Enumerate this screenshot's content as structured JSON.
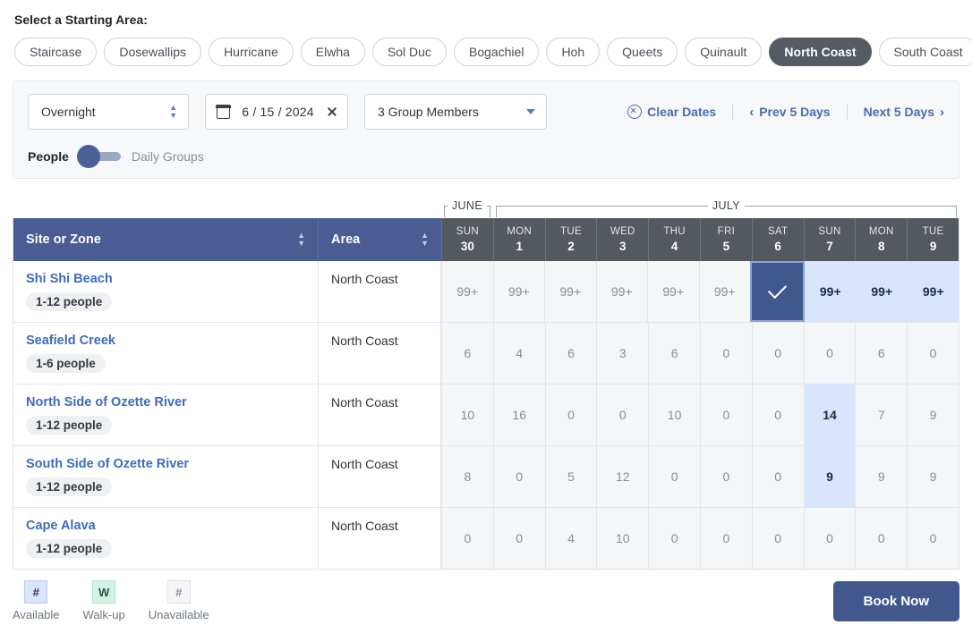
{
  "area_picker": {
    "label": "Select a Starting Area:",
    "chips": [
      {
        "label": "Staircase",
        "selected": false
      },
      {
        "label": "Dosewallips",
        "selected": false
      },
      {
        "label": "Hurricane",
        "selected": false
      },
      {
        "label": "Elwha",
        "selected": false
      },
      {
        "label": "Sol Duc",
        "selected": false
      },
      {
        "label": "Bogachiel",
        "selected": false
      },
      {
        "label": "Hoh",
        "selected": false
      },
      {
        "label": "Queets",
        "selected": false
      },
      {
        "label": "Quinault",
        "selected": false
      },
      {
        "label": "North Coast",
        "selected": true
      },
      {
        "label": "South Coast",
        "selected": false
      }
    ]
  },
  "filters": {
    "stay_type": "Overnight",
    "date_value": "6 / 15 / 2024",
    "group_size": "3 Group Members",
    "clear_dates": "Clear Dates",
    "prev_days": "Prev 5 Days",
    "next_days": "Next 5 Days",
    "prev_chevron": "‹",
    "next_chevron": "›",
    "toggle_left": "People",
    "toggle_right": "Daily Groups"
  },
  "months": [
    {
      "name": "JUNE",
      "span": 1
    },
    {
      "name": "JULY",
      "span": 9
    }
  ],
  "table": {
    "col_site": "Site or Zone",
    "col_area": "Area",
    "days": [
      {
        "dow": "SUN",
        "num": "30"
      },
      {
        "dow": "MON",
        "num": "1"
      },
      {
        "dow": "TUE",
        "num": "2"
      },
      {
        "dow": "WED",
        "num": "3"
      },
      {
        "dow": "THU",
        "num": "4"
      },
      {
        "dow": "FRI",
        "num": "5"
      },
      {
        "dow": "SAT",
        "num": "6"
      },
      {
        "dow": "SUN",
        "num": "7"
      },
      {
        "dow": "MON",
        "num": "8"
      },
      {
        "dow": "TUE",
        "num": "9"
      }
    ],
    "rows": [
      {
        "site": "Shi Shi Beach",
        "capacity": "1-12 people",
        "area": "North Coast",
        "cells": [
          {
            "value": "99+",
            "state": "plain"
          },
          {
            "value": "99+",
            "state": "plain"
          },
          {
            "value": "99+",
            "state": "plain"
          },
          {
            "value": "99+",
            "state": "plain"
          },
          {
            "value": "99+",
            "state": "plain"
          },
          {
            "value": "99+",
            "state": "plain"
          },
          {
            "value": "",
            "state": "selected"
          },
          {
            "value": "99+",
            "state": "avail"
          },
          {
            "value": "99+",
            "state": "avail"
          },
          {
            "value": "99+",
            "state": "avail"
          }
        ]
      },
      {
        "site": "Seafield Creek",
        "capacity": "1-6 people",
        "area": "North Coast",
        "cells": [
          {
            "value": "6",
            "state": "plain"
          },
          {
            "value": "4",
            "state": "plain"
          },
          {
            "value": "6",
            "state": "plain"
          },
          {
            "value": "3",
            "state": "plain"
          },
          {
            "value": "6",
            "state": "plain"
          },
          {
            "value": "0",
            "state": "plain"
          },
          {
            "value": "0",
            "state": "plain"
          },
          {
            "value": "0",
            "state": "plain"
          },
          {
            "value": "6",
            "state": "plain"
          },
          {
            "value": "0",
            "state": "plain"
          }
        ]
      },
      {
        "site": "North Side of Ozette River",
        "capacity": "1-12 people",
        "area": "North Coast",
        "cells": [
          {
            "value": "10",
            "state": "plain"
          },
          {
            "value": "16",
            "state": "plain"
          },
          {
            "value": "0",
            "state": "plain"
          },
          {
            "value": "0",
            "state": "plain"
          },
          {
            "value": "10",
            "state": "plain"
          },
          {
            "value": "0",
            "state": "plain"
          },
          {
            "value": "0",
            "state": "plain"
          },
          {
            "value": "14",
            "state": "avail"
          },
          {
            "value": "7",
            "state": "plain"
          },
          {
            "value": "9",
            "state": "plain"
          }
        ]
      },
      {
        "site": "South Side of Ozette River",
        "capacity": "1-12 people",
        "area": "North Coast",
        "cells": [
          {
            "value": "8",
            "state": "plain"
          },
          {
            "value": "0",
            "state": "plain"
          },
          {
            "value": "5",
            "state": "plain"
          },
          {
            "value": "12",
            "state": "plain"
          },
          {
            "value": "0",
            "state": "plain"
          },
          {
            "value": "0",
            "state": "plain"
          },
          {
            "value": "0",
            "state": "plain"
          },
          {
            "value": "9",
            "state": "avail"
          },
          {
            "value": "9",
            "state": "plain"
          },
          {
            "value": "9",
            "state": "plain"
          }
        ]
      },
      {
        "site": "Cape Alava",
        "capacity": "1-12 people",
        "area": "North Coast",
        "cells": [
          {
            "value": "0",
            "state": "plain"
          },
          {
            "value": "0",
            "state": "plain"
          },
          {
            "value": "4",
            "state": "plain"
          },
          {
            "value": "10",
            "state": "plain"
          },
          {
            "value": "0",
            "state": "plain"
          },
          {
            "value": "0",
            "state": "plain"
          },
          {
            "value": "0",
            "state": "plain"
          },
          {
            "value": "0",
            "state": "plain"
          },
          {
            "value": "0",
            "state": "plain"
          },
          {
            "value": "0",
            "state": "plain"
          }
        ]
      }
    ]
  },
  "footer": {
    "legend": [
      {
        "glyph": "#",
        "label": "Available",
        "kind": "lg-available"
      },
      {
        "glyph": "W",
        "label": "Walk-up",
        "kind": "lg-walkup"
      },
      {
        "glyph": "#",
        "label": "Unavailable",
        "kind": "lg-unavail"
      }
    ],
    "book_button": "Book Now"
  }
}
